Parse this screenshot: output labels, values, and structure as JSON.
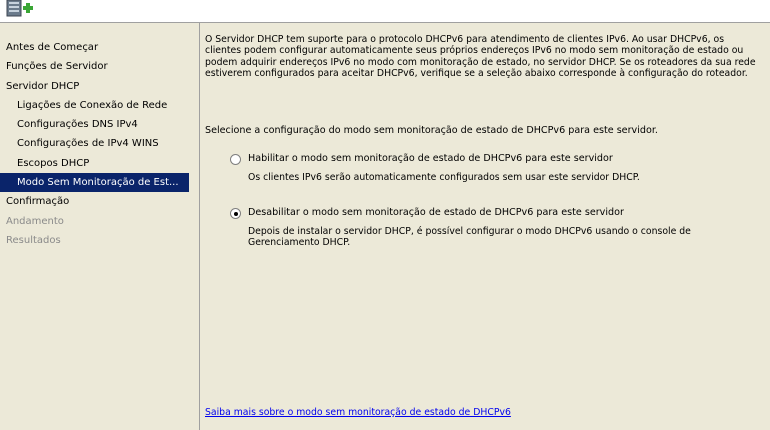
{
  "sidebar": {
    "items": [
      {
        "label": "Antes de Começar",
        "level": 0,
        "state": "normal"
      },
      {
        "label": "Funções de Servidor",
        "level": 0,
        "state": "normal"
      },
      {
        "label": "Servidor DHCP",
        "level": 0,
        "state": "normal"
      },
      {
        "label": "Ligações de Conexão de Rede",
        "level": 1,
        "state": "normal"
      },
      {
        "label": "Configurações DNS IPv4",
        "level": 1,
        "state": "normal"
      },
      {
        "label": "Configurações de IPv4 WINS",
        "level": 1,
        "state": "normal"
      },
      {
        "label": "Escopos DHCP",
        "level": 1,
        "state": "normal"
      },
      {
        "label": "Modo Sem Monitoração de Est...",
        "level": 1,
        "state": "selected"
      },
      {
        "label": "Confirmação",
        "level": 0,
        "state": "normal"
      },
      {
        "label": "Andamento",
        "level": 0,
        "state": "disabled"
      },
      {
        "label": "Resultados",
        "level": 0,
        "state": "disabled"
      }
    ]
  },
  "main": {
    "intro": "O Servidor DHCP tem suporte para o protocolo DHCPv6 para atendimento de clientes IPv6. Ao usar DHCPv6, os clientes podem configurar automaticamente seus próprios endereços IPv6 no modo sem monitoração de estado ou podem adquirir endereços IPv6 no modo com monitoração de estado, no servidor DHCP. Se os roteadores da sua rede estiverem configurados para aceitar DHCPv6, verifique se a seleção abaixo corresponde à configuração do roteador.",
    "prompt": "Selecione a configuração do modo sem monitoração de estado de DHCPv6 para este servidor.",
    "options": [
      {
        "label": "Habilitar o modo sem monitoração de estado de DHCPv6 para este servidor",
        "description": "Os clientes IPv6 serão automaticamente configurados sem usar este servidor DHCP.",
        "checked": false
      },
      {
        "label": "Desabilitar o modo sem monitoração de estado de DHCPv6 para este servidor",
        "description": "Depois de instalar o servidor DHCP, é possível configurar o modo DHCPv6 usando o console de Gerenciamento DHCP.",
        "checked": true
      }
    ],
    "help_link": "Saiba mais sobre o modo sem monitoração de estado de DHCPv6"
  },
  "icons": {
    "header": "server-role-icon"
  },
  "colors": {
    "panel_bg": "#ece9d8",
    "selection_bg": "#0a246a",
    "link": "#0000ee",
    "disabled_text": "#8a8a8a"
  }
}
